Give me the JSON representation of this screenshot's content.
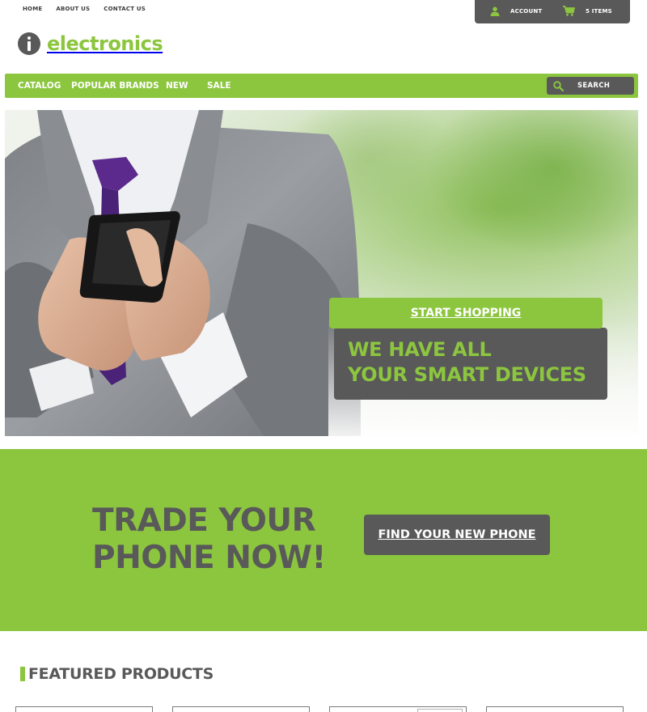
{
  "top_nav": {
    "links": [
      "HOME",
      "ABOUT US",
      "CONTACT US"
    ]
  },
  "account_bar": {
    "account_label": "ACCOUNT",
    "cart_label": "5 ITEMS"
  },
  "logo": {
    "text": "electronics",
    "icon": "info-icon"
  },
  "main_nav": {
    "items": [
      "CATALOG",
      "POPULAR BRANDS",
      "NEW",
      "SALE"
    ],
    "search_placeholder": "SEARCH"
  },
  "hero": {
    "headline_line1": "WE HAVE ALL",
    "headline_line2": "YOUR SMART DEVICES",
    "cta_label": "START SHOPPING"
  },
  "trade": {
    "title_line1": "TRADE YOUR",
    "title_line2": "PHONE NOW!",
    "button_label": "FIND YOUR NEW PHONE"
  },
  "featured": {
    "heading": "FEATURED PRODUCTS",
    "card_count": 4
  },
  "colors": {
    "brand_green": "#8cc63f",
    "dark_gray": "#595959",
    "white": "#ffffff"
  }
}
